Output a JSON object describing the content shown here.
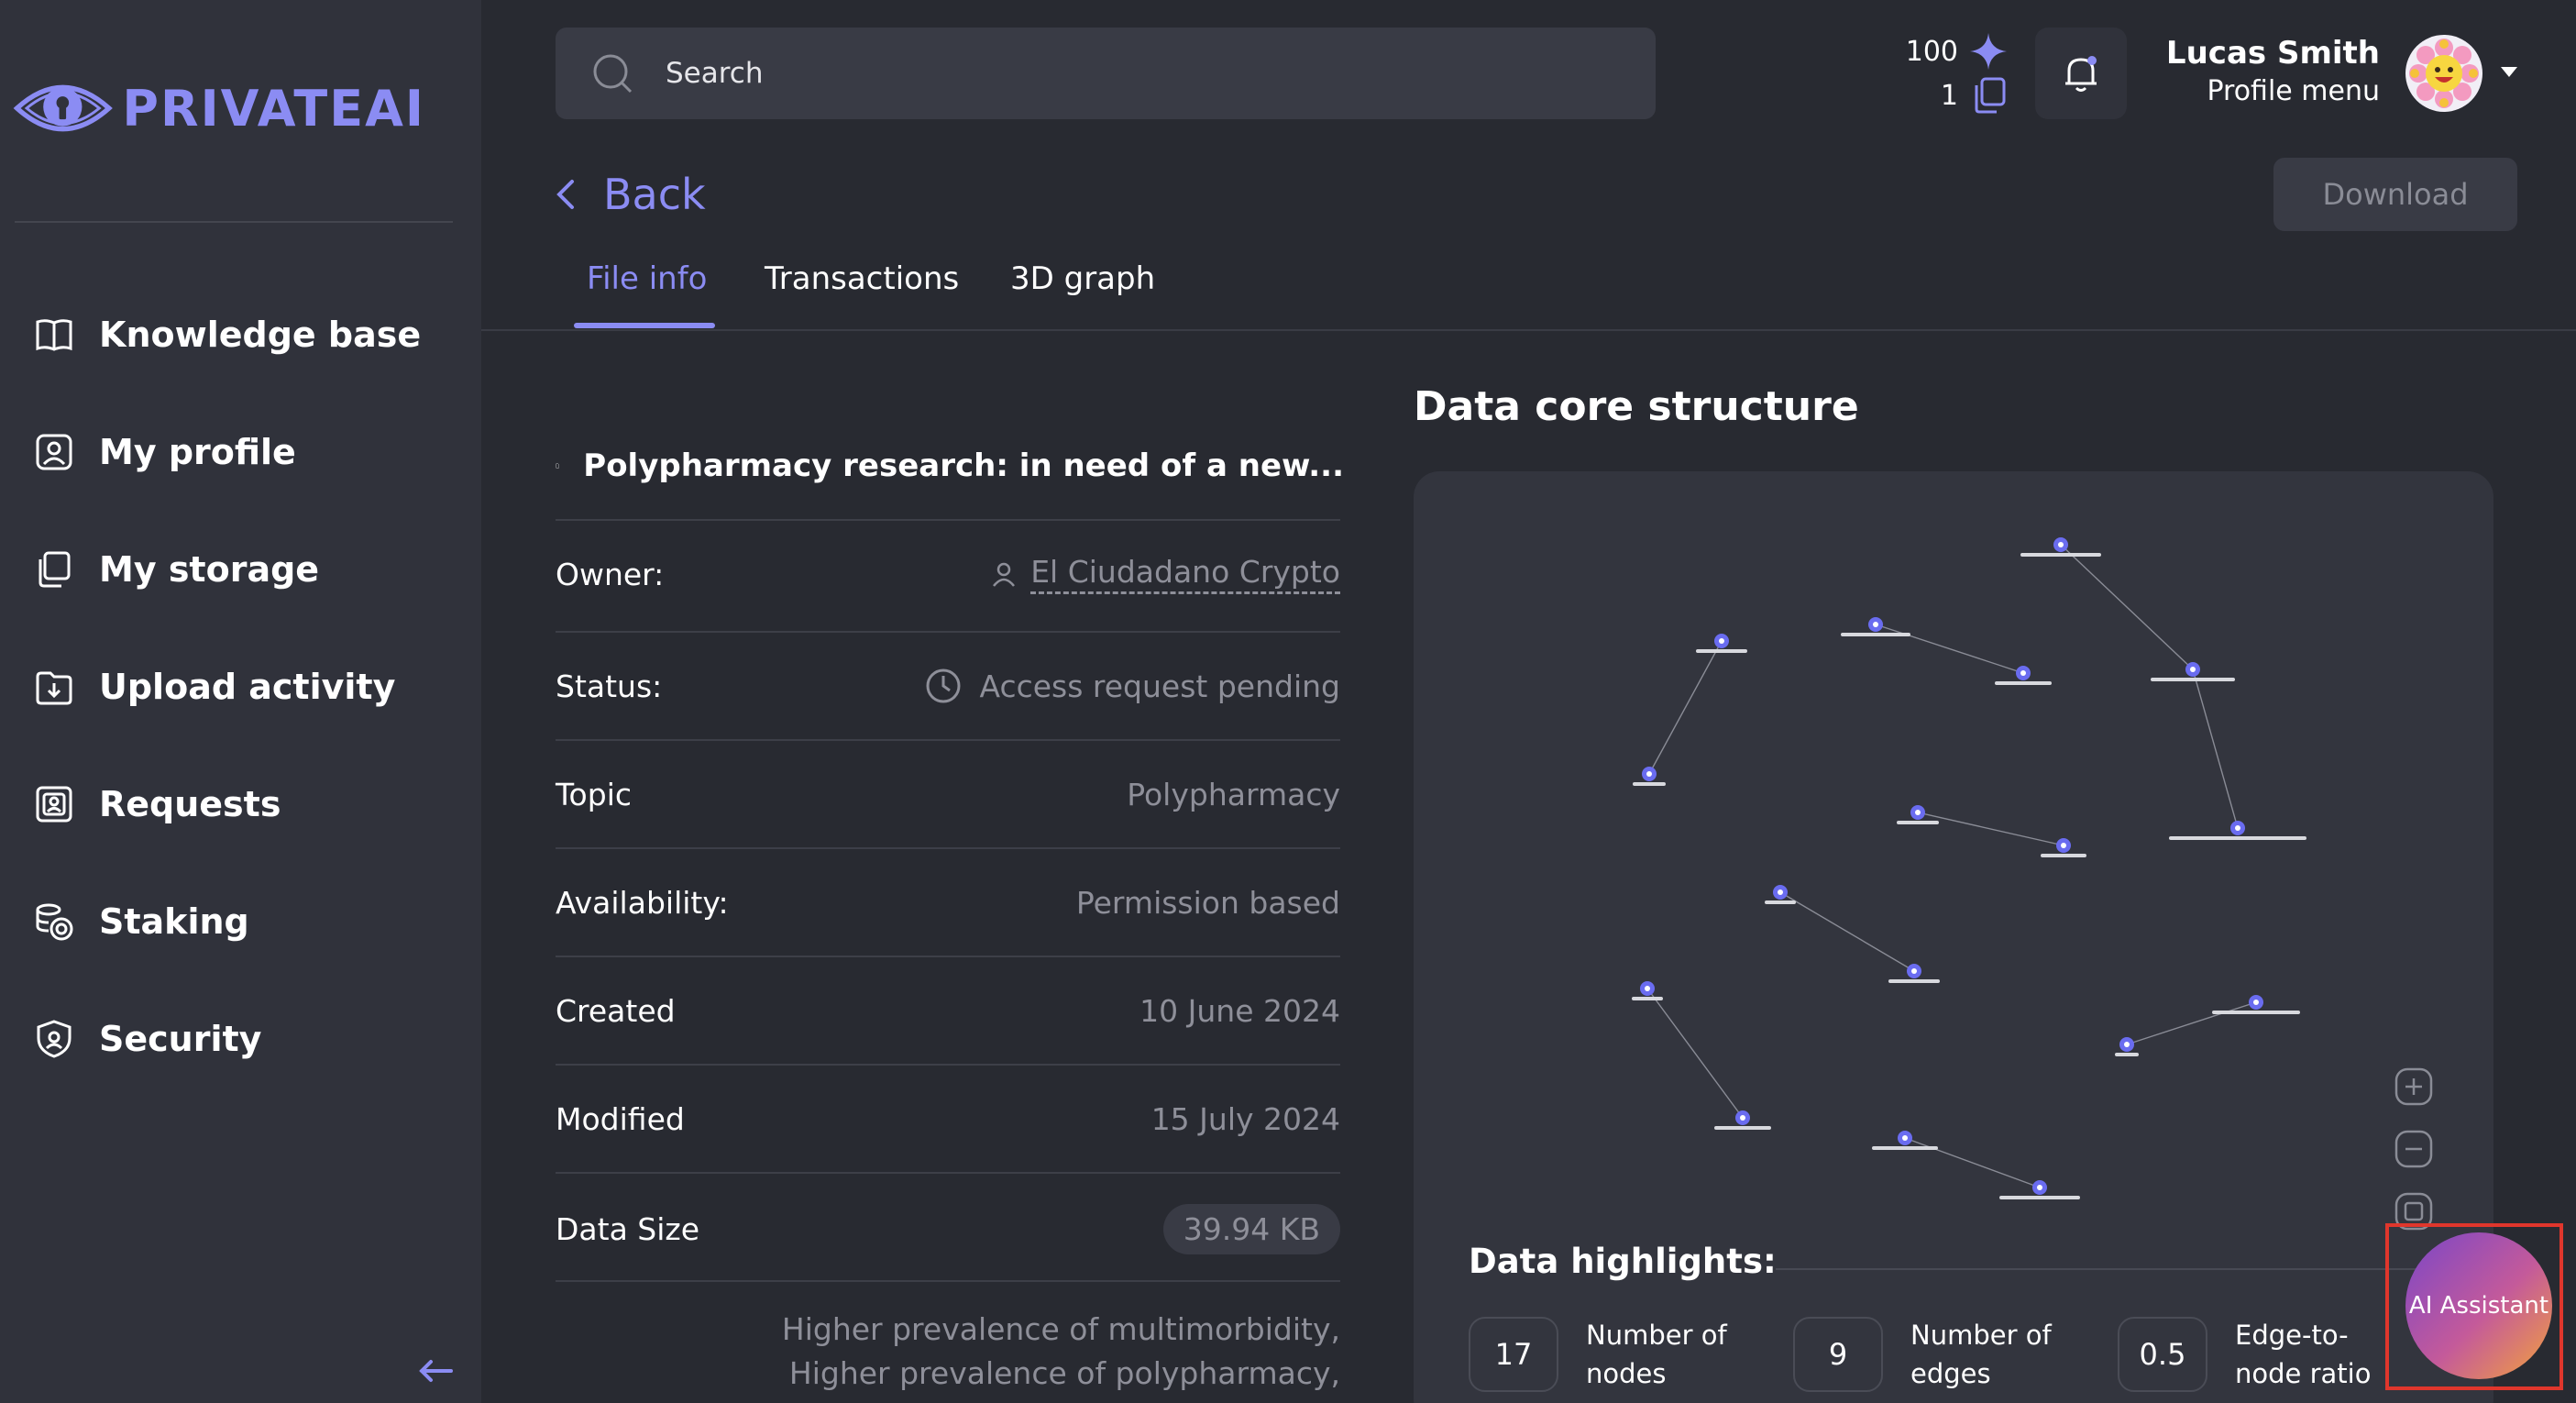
{
  "app": {
    "logo_text": "PRIVATEAI"
  },
  "sidebar": {
    "items": [
      {
        "label": "Knowledge base",
        "icon": "book-icon"
      },
      {
        "label": "My profile",
        "icon": "profile-icon"
      },
      {
        "label": "My storage",
        "icon": "storage-icon"
      },
      {
        "label": "Upload activity",
        "icon": "upload-activity-icon"
      },
      {
        "label": "Requests",
        "icon": "requests-icon"
      },
      {
        "label": "Staking",
        "icon": "coins-icon"
      },
      {
        "label": "Security",
        "icon": "shield-icon"
      }
    ],
    "collapse_icon": "arrow-left-icon"
  },
  "header": {
    "search_placeholder": "Search",
    "credits": "100",
    "files": "1",
    "user_name": "Lucas Smith",
    "user_sub": "Profile menu"
  },
  "page": {
    "back_label": "Back",
    "download_label": "Download",
    "tabs": [
      {
        "label": "File info",
        "active": true
      },
      {
        "label": "Transactions",
        "active": false
      },
      {
        "label": "3D graph",
        "active": false
      }
    ]
  },
  "file": {
    "title": "Polypharmacy research: in need of a new...",
    "rows": [
      {
        "label": "Owner:",
        "value": "El Ciudadano Crypto"
      },
      {
        "label": "Status:",
        "value": "Access request pending"
      },
      {
        "label": "Topic",
        "value": "Polypharmacy"
      },
      {
        "label": "Availability:",
        "value": "Permission based"
      },
      {
        "label": "Created",
        "value": "10 June 2024"
      },
      {
        "label": "Modified",
        "value": "15 July 2024"
      },
      {
        "label": "Data Size",
        "value": "39.94 KB"
      }
    ],
    "description_lines": [
      "Higher prevalence of multimorbidity,",
      "Higher prevalence of polypharmacy,"
    ]
  },
  "graph": {
    "title": "Data core structure",
    "highlights_title": "Data highlights:",
    "stats": [
      {
        "value": "17",
        "label": "Number of nodes"
      },
      {
        "value": "9",
        "label": "Number of edges"
      },
      {
        "value": "0.5",
        "label": "Edge-to-node ratio"
      }
    ],
    "node_color": "#6a6cf0"
  },
  "assistant": {
    "label": "AI Assistant"
  },
  "colors": {
    "accent": "#8b8cf3",
    "background": "#282a31",
    "sidebar": "#30323b",
    "highlight_frame": "#e0362c"
  }
}
